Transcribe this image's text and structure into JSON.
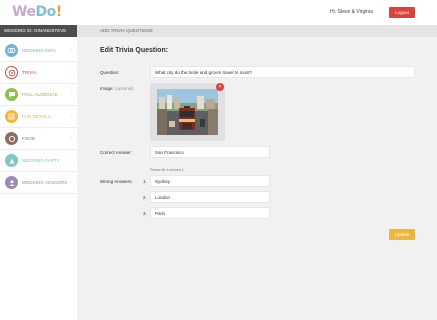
{
  "header": {
    "logo_we": "We",
    "logo_do": "Do",
    "logo_bang": "!",
    "greeting": "Hi, Steve & Virginia",
    "logout_label": "Logout"
  },
  "sidebar": {
    "wedding_id": "WEDDING ID: GINANDSTEVE",
    "items": [
      {
        "label": "WEDDING INFO",
        "icon": "rings-icon",
        "color": "#6fb3d6"
      },
      {
        "label": "TRIVIA",
        "icon": "trivia-icon",
        "color": "#d9443c"
      },
      {
        "label": "POLL AUDIENCE",
        "icon": "poll-icon",
        "color": "#8bc34a"
      },
      {
        "label": "FUN DETAILS",
        "icon": "details-icon",
        "color": "#f0b63a"
      },
      {
        "label": "FOOD",
        "icon": "food-icon",
        "color": "#8d6e63"
      },
      {
        "label": "WEDDING PARTY",
        "icon": "party-icon",
        "color": "#7fc6c6"
      },
      {
        "label": "WEDDING VENDORS",
        "icon": "vendors-icon",
        "color": "#9a8bb5"
      }
    ]
  },
  "breadcrumb": "ADD TRIVIA QUESTIONS",
  "form": {
    "title": "Edit Trivia Question:",
    "question_label": "Question:",
    "question_value": "What city do the bride and groom travel to most?",
    "image_label": "Image:",
    "image_optional": "(optional)",
    "correct_label": "Correct Answer:",
    "correct_value": "San Francisco",
    "hint": "Please fill in at least 1",
    "wrong_label": "Wrong Answers:",
    "wrong_answers": [
      {
        "num": "1.",
        "value": "Sydney"
      },
      {
        "num": "2.",
        "value": "London"
      },
      {
        "num": "3.",
        "value": "Paris"
      }
    ],
    "update_label": "Update"
  }
}
